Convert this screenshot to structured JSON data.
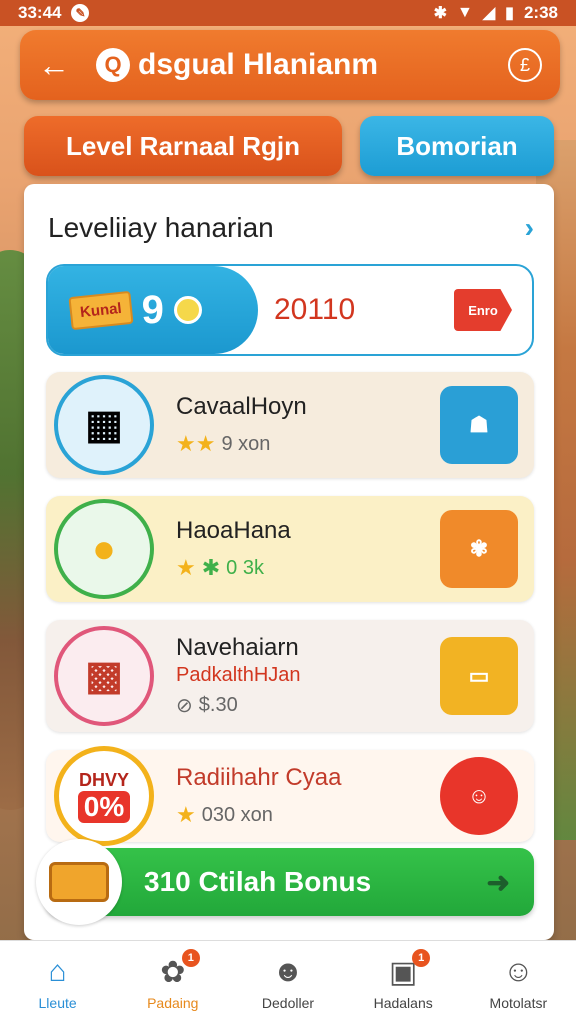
{
  "status_bar": {
    "time_left": "33:44",
    "time_right": "2:38",
    "icons": [
      "compass-icon",
      "bluetooth-icon",
      "wifi-icon",
      "signal-icon",
      "battery-icon"
    ]
  },
  "header": {
    "title": "dsgual Hlanianm",
    "logo_glyph": "Q",
    "back_glyph": "←",
    "action_glyph": "£"
  },
  "top_buttons": {
    "level_label": "Level Rarnaal Rgjn",
    "bomorian_label": "Bomorian"
  },
  "section": {
    "title": "Leveliiay hanarian",
    "arrow": "›"
  },
  "featured": {
    "tag": "Kunal",
    "number": "9",
    "value": "20110",
    "ticket": "Enro"
  },
  "list": [
    {
      "name": "CavaalHoyn",
      "meta_stars": "★★",
      "meta_text": "9 xon",
      "bg": "#f6ecdd",
      "avatar_color": "#2aa3d6",
      "art_color": "#2a9fd6"
    },
    {
      "name": "HaoaHana",
      "meta_star1": "★",
      "meta_star2": "✱",
      "meta_text": "0 3k",
      "bg": "#fbf0c6",
      "avatar_color": "#3fb04a",
      "art_color": "#f08a2a"
    },
    {
      "name": "Navehaiarn",
      "subtitle": "PadkalthHJan",
      "meta_icon": "⊘",
      "meta_text": "$.30",
      "bg": "#f6f0ec",
      "avatar_color": "#e0577a",
      "art_color": "#f2b323"
    },
    {
      "name": "Radiihahr Cyaa",
      "meta_stars": "★",
      "meta_text": "030 xon",
      "badge_top": "DHVY",
      "badge_bottom": "0%",
      "bg": "#fff6ee",
      "avatar_color": "#f3b21b",
      "art_color": "#e8352a"
    }
  ],
  "bonus": {
    "label": "310 Ctilah Bonus",
    "arrow": "➜"
  },
  "bottom_nav": [
    {
      "label": "Lleute",
      "icon": "home-icon",
      "glyph": "⌂"
    },
    {
      "label": "Padaing",
      "icon": "gear-icon",
      "glyph": "✿",
      "badge": "1"
    },
    {
      "label": "Dedoller",
      "icon": "chat-icon",
      "glyph": "☻"
    },
    {
      "label": "Hadalans",
      "icon": "store-icon",
      "glyph": "▣",
      "badge": "1"
    },
    {
      "label": "Motolatsr",
      "icon": "user-icon",
      "glyph": "☺"
    }
  ]
}
